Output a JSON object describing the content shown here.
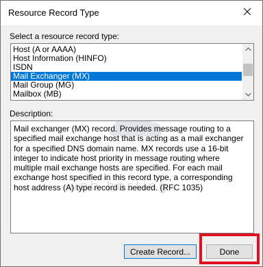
{
  "window": {
    "title": "Resource Record Type"
  },
  "select": {
    "label": "Select a resource record type:",
    "items": [
      {
        "label": "Host (A or AAAA)",
        "selected": false
      },
      {
        "label": "Host Information (HINFO)",
        "selected": false
      },
      {
        "label": "ISDN",
        "selected": false
      },
      {
        "label": "Mail Exchanger (MX)",
        "selected": true
      },
      {
        "label": "Mail Group (MG)",
        "selected": false
      },
      {
        "label": "Mailbox (MB)",
        "selected": false
      }
    ]
  },
  "description": {
    "label": "Description:",
    "text": "Mail exchanger (MX) record. Provides message routing to a specified mail exchange host that is acting as a mail exchanger for a specified DNS domain name. MX records use a 16-bit integer to indicate host priority in message routing where multiple mail exchange hosts are specified. For each mail exchange host specified in this record type, a corresponding host address (A) type record is needed. (RFC 1035)"
  },
  "watermark": {
    "text": "web hosting"
  },
  "buttons": {
    "create": "Create Record...",
    "done": "Done"
  },
  "colors": {
    "selection": "#0078d7",
    "highlight": "#e0101e"
  }
}
